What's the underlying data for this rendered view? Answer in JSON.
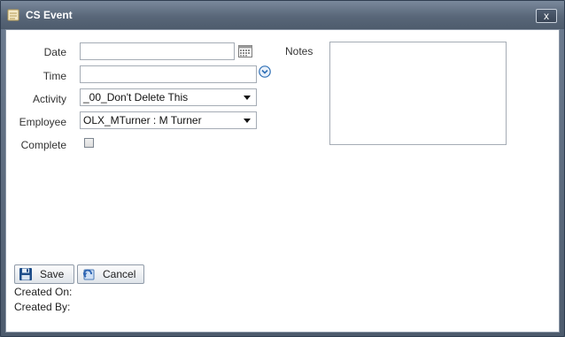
{
  "window": {
    "title": "CS Event",
    "close_label": "x"
  },
  "form": {
    "date": {
      "label": "Date",
      "value": ""
    },
    "time": {
      "label": "Time",
      "value": ""
    },
    "activity": {
      "label": "Activity",
      "value": "_00_Don't Delete This"
    },
    "employee": {
      "label": "Employee",
      "value": "OLX_MTurner : M Turner"
    },
    "complete": {
      "label": "Complete",
      "checked": false
    },
    "notes": {
      "label": "Notes",
      "value": ""
    }
  },
  "buttons": {
    "save": "Save",
    "cancel": "Cancel"
  },
  "meta": {
    "created_on": "Created On:",
    "created_by": "Created By:"
  },
  "icons": {
    "window": "document-icon",
    "calendar": "calendar-icon",
    "time_dropdown": "clock-dropdown-icon",
    "save": "floppy-icon",
    "cancel": "undo-icon"
  }
}
